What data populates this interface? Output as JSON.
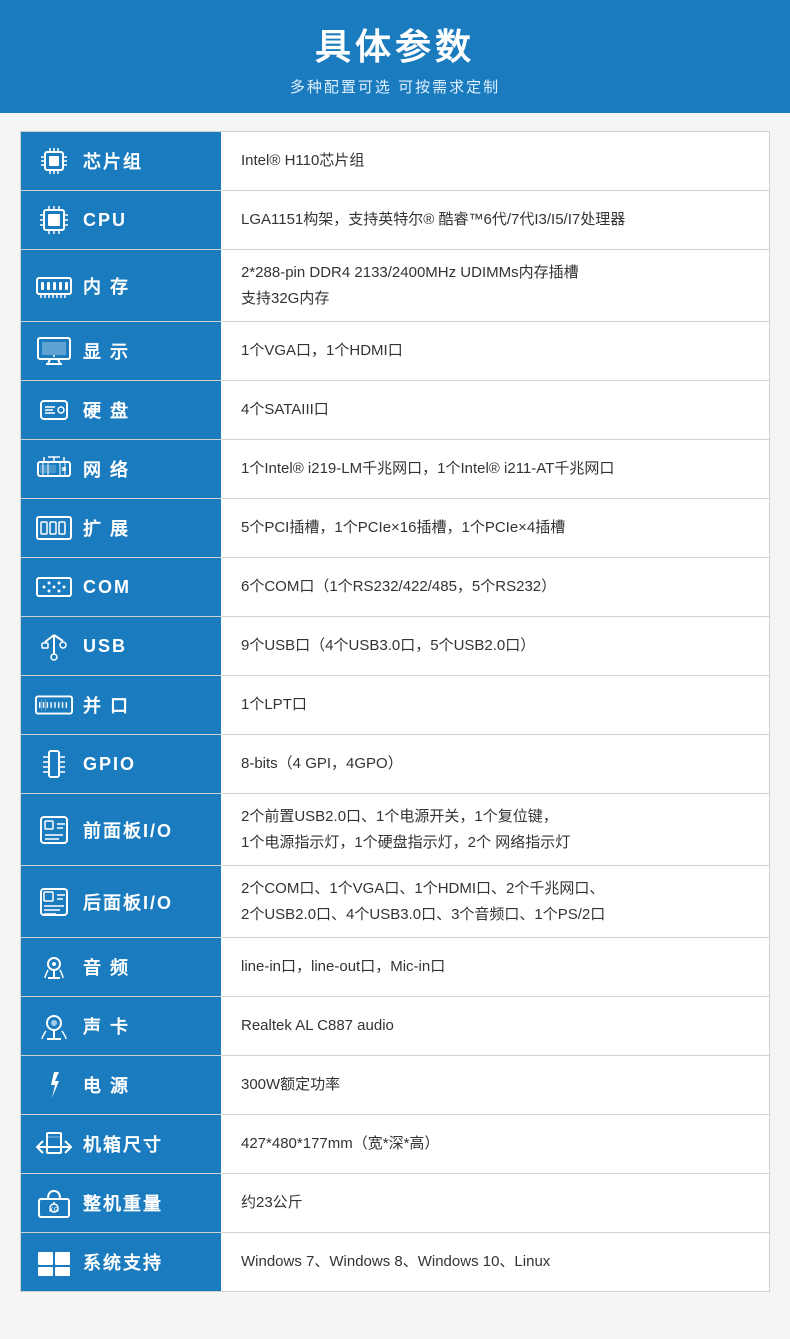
{
  "header": {
    "title": "具体参数",
    "subtitle": "多种配置可选 可按需求定制"
  },
  "rows": [
    {
      "id": "chipset",
      "icon": "chipset",
      "label": "芯片组",
      "value": "Intel® H110芯片组"
    },
    {
      "id": "cpu",
      "icon": "cpu",
      "label": "CPU",
      "value": "LGA1151构架，支持英特尔® 酷睿™6代/7代I3/I5/I7处理器"
    },
    {
      "id": "memory",
      "icon": "memory",
      "label": "内 存",
      "value": "2*288-pin DDR4 2133/2400MHz UDIMMs内存插槽\n支持32G内存"
    },
    {
      "id": "display",
      "icon": "display",
      "label": "显 示",
      "value": "1个VGA口，1个HDMI口"
    },
    {
      "id": "harddisk",
      "icon": "harddisk",
      "label": "硬 盘",
      "value": "4个SATAIII口"
    },
    {
      "id": "network",
      "icon": "network",
      "label": "网 络",
      "value": "1个Intel® i219-LM千兆网口，1个Intel® i211-AT千兆网口"
    },
    {
      "id": "expansion",
      "icon": "expansion",
      "label": "扩 展",
      "value": "5个PCI插槽，1个PCIe×16插槽，1个PCIe×4插槽"
    },
    {
      "id": "com",
      "icon": "com",
      "label": "COM",
      "value": "6个COM口（1个RS232/422/485，5个RS232）"
    },
    {
      "id": "usb",
      "icon": "usb",
      "label": "USB",
      "value": "9个USB口（4个USB3.0口，5个USB2.0口）"
    },
    {
      "id": "parallel",
      "icon": "parallel",
      "label": "并 口",
      "value": "1个LPT口"
    },
    {
      "id": "gpio",
      "icon": "gpio",
      "label": "GPIO",
      "value": "8-bits（4 GPI，4GPO）"
    },
    {
      "id": "front-io",
      "icon": "front-io",
      "label": "前面板I/O",
      "value": "2个前置USB2.0口、1个电源开关，1个复位键，\n1个电源指示灯，1个硬盘指示灯，2个 网络指示灯"
    },
    {
      "id": "rear-io",
      "icon": "rear-io",
      "label": "后面板I/O",
      "value": "2个COM口、1个VGA口、1个HDMI口、2个千兆网口、\n2个USB2.0口、4个USB3.0口、3个音频口、1个PS/2口"
    },
    {
      "id": "audio",
      "icon": "audio",
      "label": "音 频",
      "value": "line-in口，line-out口，Mic-in口"
    },
    {
      "id": "soundcard",
      "icon": "soundcard",
      "label": "声 卡",
      "value": "Realtek AL C887 audio"
    },
    {
      "id": "power",
      "icon": "power",
      "label": "电 源",
      "value": "300W额定功率"
    },
    {
      "id": "dimensions",
      "icon": "dimensions",
      "label": "机箱尺寸",
      "value": "427*480*177mm（宽*深*高）"
    },
    {
      "id": "weight",
      "icon": "weight",
      "label": "整机重量",
      "value": "约23公斤"
    },
    {
      "id": "os",
      "icon": "os",
      "label": "系统支持",
      "value": "Windows 7、Windows 8、Windows 10、Linux"
    }
  ]
}
